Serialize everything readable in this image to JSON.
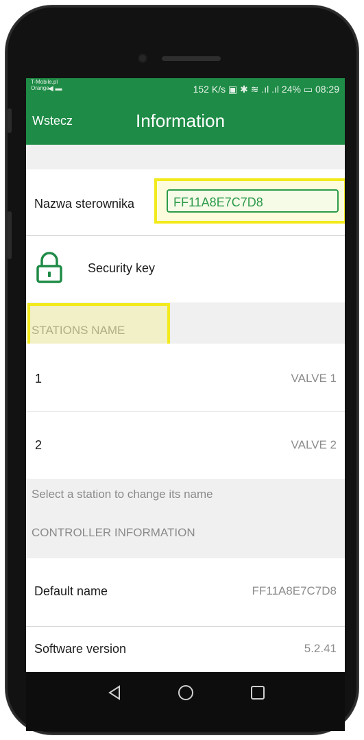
{
  "status_bar": {
    "carrier_line1": "T-Mobile.pl",
    "carrier_line2": "Orange",
    "speed": "152 K/s",
    "battery": "24%",
    "time": "08:29"
  },
  "app_bar": {
    "back_label": "Wstecz",
    "title": "Information"
  },
  "controller_name": {
    "label": "Nazwa sterownika",
    "value": "FF11A8E7C7D8"
  },
  "security": {
    "label": "Security key",
    "icon": "lock-icon"
  },
  "stations": {
    "header": "STATIONS NAME",
    "items": [
      {
        "number": "1",
        "name": "VALVE 1"
      },
      {
        "number": "2",
        "name": "VALVE 2"
      }
    ],
    "hint": "Select a station to change its name"
  },
  "controller_info": {
    "header": "CONTROLLER INFORMATION",
    "items": [
      {
        "label": "Default name",
        "value": "FF11A8E7C7D8"
      },
      {
        "label": "Software version",
        "value": "5.2.41"
      }
    ]
  },
  "nav_bar": {
    "icons": [
      "back-triangle-icon",
      "home-circle-icon",
      "recents-square-icon"
    ]
  },
  "colors": {
    "brand_green": "#1e8b46",
    "highlight_yellow": "#f2ea1c"
  }
}
